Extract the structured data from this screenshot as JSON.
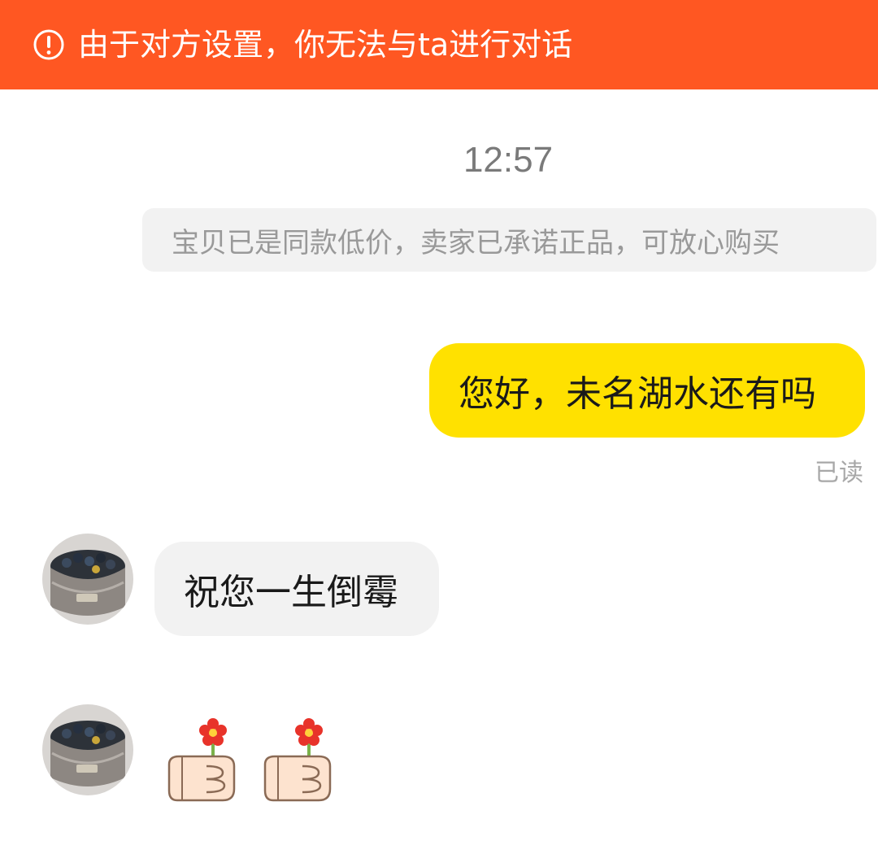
{
  "banner": {
    "icon": "exclamation-circle-icon",
    "text": "由于对方设置，你无法与ta进行对话",
    "color": "#ff5722"
  },
  "chat": {
    "timestamp": "12:57",
    "system_notice": "宝贝已是同款低价，卖家已承诺正品，可放心购买",
    "messages": [
      {
        "direction": "outgoing",
        "text": "您好，未名湖水还有吗",
        "status": "已读",
        "bubble_color": "#ffe100"
      },
      {
        "direction": "incoming",
        "text": "祝您一生倒霉",
        "bubble_color": "#f2f2f2"
      },
      {
        "direction": "incoming",
        "emoji": [
          "hand-holding-flower-icon",
          "hand-holding-flower-icon"
        ]
      }
    ]
  }
}
